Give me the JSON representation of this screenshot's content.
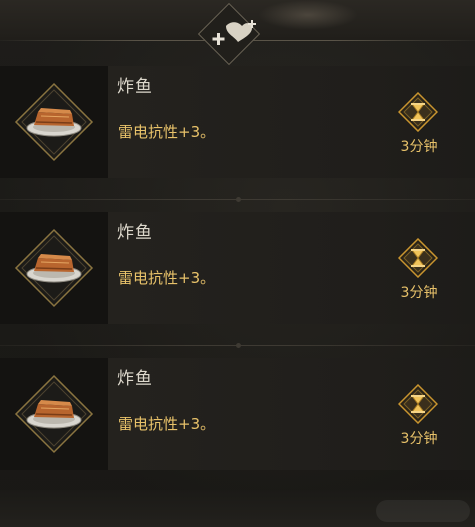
{
  "header": {
    "badge_icon": "buff-plus-icon"
  },
  "food_list": [
    {
      "name": "炸鱼",
      "effect": "雷电抗性+3。",
      "duration": "3分钟",
      "icon": "fried-fish-icon",
      "timer_icon": "hourglass-icon"
    },
    {
      "name": "炸鱼",
      "effect": "雷电抗性+3。",
      "duration": "3分钟",
      "icon": "fried-fish-icon",
      "timer_icon": "hourglass-icon"
    },
    {
      "name": "炸鱼",
      "effect": "雷电抗性+3。",
      "duration": "3分钟",
      "icon": "fried-fish-icon",
      "timer_icon": "hourglass-icon"
    }
  ],
  "colors": {
    "accent_gold": "#e8c26a",
    "title_text": "#ddd8cc",
    "panel_bg": "#201e1b"
  }
}
